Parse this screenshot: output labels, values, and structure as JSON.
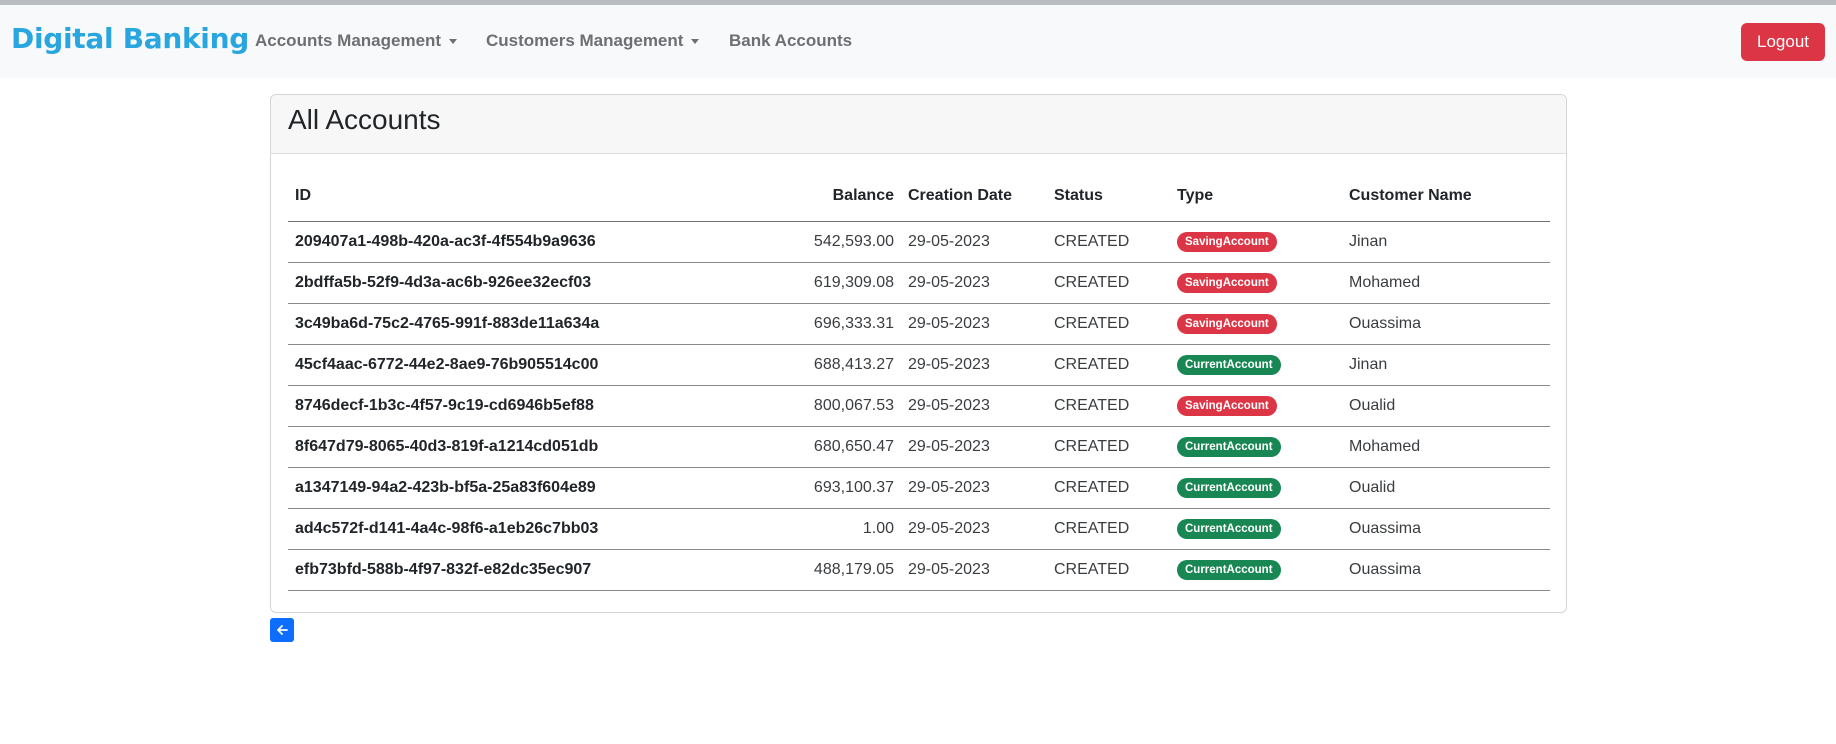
{
  "navbar": {
    "brand": "Digital Banking",
    "items": [
      {
        "label": "Accounts Management",
        "dropdown": true
      },
      {
        "label": "Customers Management",
        "dropdown": true
      },
      {
        "label": "Bank Accounts",
        "dropdown": false
      }
    ],
    "logout_label": "Logout"
  },
  "card": {
    "title": "All Accounts"
  },
  "table": {
    "headers": {
      "id": "ID",
      "balance": "Balance",
      "date": "Creation Date",
      "status": "Status",
      "type": "Type",
      "customer": "Customer Name"
    },
    "rows": [
      {
        "id": "209407a1-498b-420a-ac3f-4f554b9a9636",
        "balance": "542,593.00",
        "date": "29-05-2023",
        "status": "CREATED",
        "type": "SavingAccount",
        "customer": "Jinan"
      },
      {
        "id": "2bdffa5b-52f9-4d3a-ac6b-926ee32ecf03",
        "balance": "619,309.08",
        "date": "29-05-2023",
        "status": "CREATED",
        "type": "SavingAccount",
        "customer": "Mohamed"
      },
      {
        "id": "3c49ba6d-75c2-4765-991f-883de11a634a",
        "balance": "696,333.31",
        "date": "29-05-2023",
        "status": "CREATED",
        "type": "SavingAccount",
        "customer": "Ouassima"
      },
      {
        "id": "45cf4aac-6772-44e2-8ae9-76b905514c00",
        "balance": "688,413.27",
        "date": "29-05-2023",
        "status": "CREATED",
        "type": "CurrentAccount",
        "customer": "Jinan"
      },
      {
        "id": "8746decf-1b3c-4f57-9c19-cd6946b5ef88",
        "balance": "800,067.53",
        "date": "29-05-2023",
        "status": "CREATED",
        "type": "SavingAccount",
        "customer": "Oualid"
      },
      {
        "id": "8f647d79-8065-40d3-819f-a1214cd051db",
        "balance": "680,650.47",
        "date": "29-05-2023",
        "status": "CREATED",
        "type": "CurrentAccount",
        "customer": "Mohamed"
      },
      {
        "id": "a1347149-94a2-423b-bf5a-25a83f604e89",
        "balance": "693,100.37",
        "date": "29-05-2023",
        "status": "CREATED",
        "type": "CurrentAccount",
        "customer": "Oualid"
      },
      {
        "id": "ad4c572f-d141-4a4c-98f6-a1eb26c7bb03",
        "balance": "1.00",
        "date": "29-05-2023",
        "status": "CREATED",
        "type": "CurrentAccount",
        "customer": "Ouassima"
      },
      {
        "id": "efb73bfd-588b-4f97-832f-e82dc35ec907",
        "balance": "488,179.05",
        "date": "29-05-2023",
        "status": "CREATED",
        "type": "CurrentAccount",
        "customer": "Ouassima"
      }
    ]
  },
  "back_button": {
    "icon": "arrow-left-icon"
  },
  "colors": {
    "brand": "#29a6e0",
    "logout": "#dc3545",
    "saving_badge": "#dc3545",
    "current_badge": "#198754",
    "back_button": "#0d6efd"
  }
}
